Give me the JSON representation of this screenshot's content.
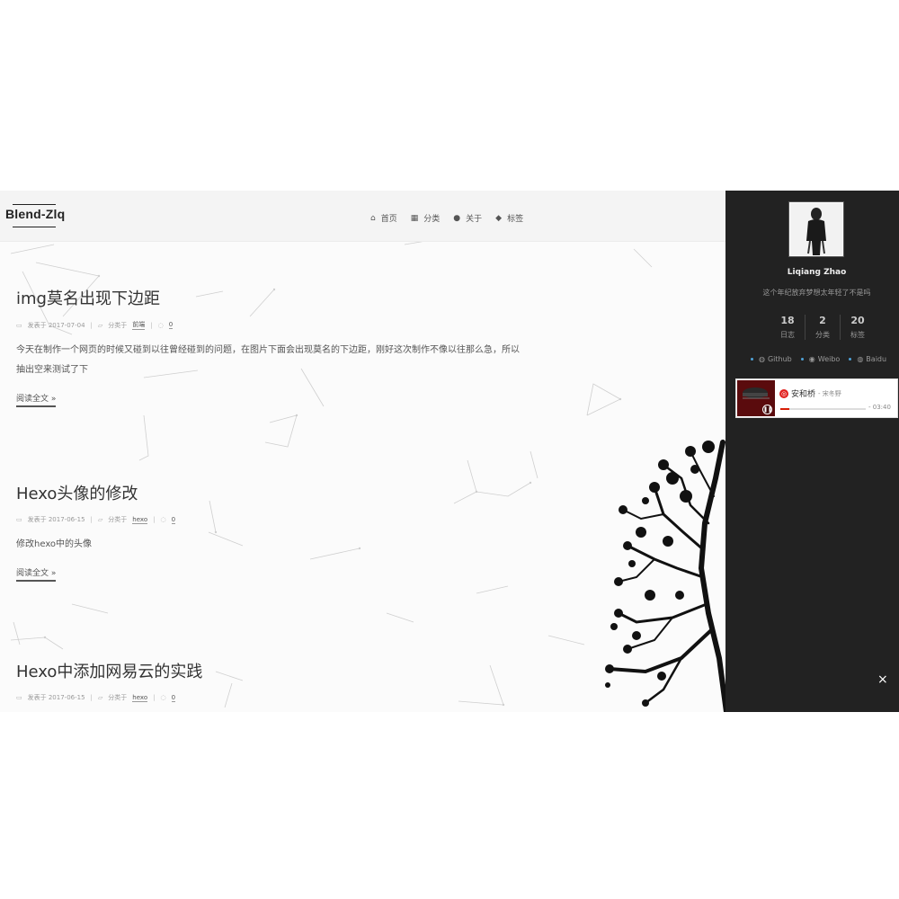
{
  "header": {
    "logo": "Blend-Zlq",
    "nav": [
      {
        "icon": "home-icon",
        "glyph": "⌂",
        "label": "首页"
      },
      {
        "icon": "grid-icon",
        "glyph": "▦",
        "label": "分类"
      },
      {
        "icon": "user-icon",
        "glyph": "●",
        "label": "关于"
      },
      {
        "icon": "tags-icon",
        "glyph": "◆",
        "label": "标签"
      }
    ]
  },
  "posts": [
    {
      "title": "img莫名出现下边距",
      "date_label": "发表于 2017-07-04",
      "category_prefix": "分类于",
      "category": "前端",
      "comments": "0",
      "excerpt_line1": "今天在制作一个网页的时候又碰到以往曾经碰到的问题，在图片下面会出现莫名的下边距，刚好这次制作不像以往那么急，所以",
      "excerpt_line2": "抽出空来测试了下",
      "readmore": "阅读全文 »"
    },
    {
      "title": "Hexo头像的修改",
      "date_label": "发表于 2017-06-15",
      "category_prefix": "分类于",
      "category": "hexo",
      "comments": "0",
      "excerpt_line1": "修改hexo中的头像",
      "readmore": "阅读全文 »"
    },
    {
      "title": "Hexo中添加网易云的实践",
      "date_label": "发表于 2017-06-15",
      "category_prefix": "分类于",
      "category": "hexo",
      "comments": "0"
    }
  ],
  "sidebar": {
    "author_name": "Liqiang Zhao",
    "author_desc": "这个年纪放弃梦想太年轻了不是吗",
    "stats": [
      {
        "num": "18",
        "label": "日志"
      },
      {
        "num": "2",
        "label": "分类"
      },
      {
        "num": "20",
        "label": "标签"
      }
    ],
    "links": [
      {
        "icon": "globe-icon",
        "label": "Github"
      },
      {
        "icon": "weibo-icon",
        "label": "Weibo"
      },
      {
        "icon": "globe-icon",
        "label": "Baidu"
      }
    ],
    "player": {
      "song": "安和桥",
      "artist": "- 宋冬野",
      "time": "- 03:40",
      "progress": 0.1
    },
    "close": "×"
  },
  "colors": {
    "sidebar_bg": "#222222",
    "header_bg": "#f4f4f4",
    "accent_red": "#d81e06"
  }
}
